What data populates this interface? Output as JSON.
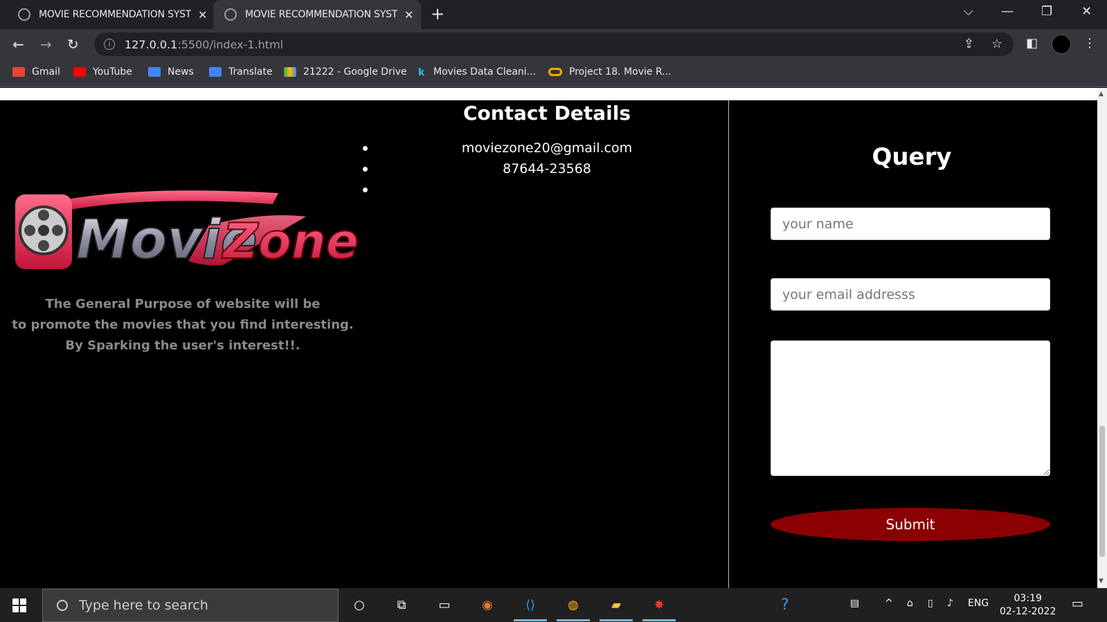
{
  "browser": {
    "tabs": [
      {
        "title": "MOVIE RECOMMENDATION SYSTEM",
        "active": false
      },
      {
        "title": "MOVIE RECOMMENDATION SYSTEM",
        "active": true
      }
    ],
    "url_host": "127.0.0.1",
    "url_path": ":5500/index-1.html",
    "bookmarks": [
      {
        "label": "Gmail",
        "icon": "gmail-icon",
        "color": "#ea4335"
      },
      {
        "label": "YouTube",
        "icon": "youtube-icon",
        "color": "#ff0000"
      },
      {
        "label": "News",
        "icon": "news-icon",
        "color": "#4285f4"
      },
      {
        "label": "Translate",
        "icon": "translate-icon",
        "color": "#4285f4"
      },
      {
        "label": "21222 - Google Drive",
        "icon": "drive-icon",
        "color": "#34a853"
      },
      {
        "label": "Movies Data Cleani...",
        "icon": "kaggle-icon",
        "color": "#20beff"
      },
      {
        "label": "Project 18. Movie R...",
        "icon": "colab-icon",
        "color": "#f9ab00"
      }
    ]
  },
  "contact": {
    "title": "Contact Details",
    "items": [
      "moviezone20@gmail.com",
      "87644-23568",
      ""
    ]
  },
  "logo": {
    "text_left": "Movie",
    "text_right": "Zone"
  },
  "description": {
    "line1": "The General Purpose of website will be",
    "line2": "to promote the movies that you find interesting.",
    "line3": "By Sparking the user's interest!!."
  },
  "query": {
    "title": "Query",
    "name_placeholder": "your name",
    "email_placeholder": "your email addresss",
    "message_value": "",
    "submit_label": "Submit"
  },
  "taskbar": {
    "search_placeholder": "Type here to search",
    "lang": "ENG",
    "time": "03:19",
    "date": "02-12-2022"
  },
  "colors": {
    "submit": "#8b0000",
    "page_bg": "#000000"
  }
}
